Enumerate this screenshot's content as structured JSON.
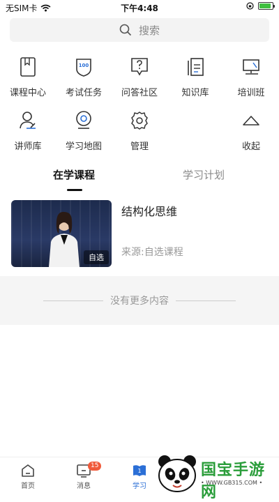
{
  "status": {
    "carrier": "无SIM卡",
    "time": "下午4:48"
  },
  "search": {
    "placeholder": "搜索"
  },
  "grid": {
    "row1": [
      {
        "label": "课程中心",
        "icon": "bookmark-book-icon"
      },
      {
        "label": "考试任务",
        "icon": "exam-shield-icon"
      },
      {
        "label": "问答社区",
        "icon": "question-bubble-icon"
      },
      {
        "label": "知识库",
        "icon": "knowledge-book-icon"
      },
      {
        "label": "培训班",
        "icon": "training-screen-icon"
      }
    ],
    "row2": [
      {
        "label": "讲师库",
        "icon": "lecturer-icon"
      },
      {
        "label": "学习地图",
        "icon": "map-pin-icon"
      },
      {
        "label": "管理",
        "icon": "gear-icon"
      },
      {
        "label": "收起",
        "icon": "collapse-up-icon"
      }
    ]
  },
  "tabs": {
    "active": "在学课程",
    "inactive": "学习计划"
  },
  "course": {
    "title": "结构化思维",
    "source": "来源:自选课程",
    "tag": "自选"
  },
  "no_more": "没有更多内容",
  "nav": {
    "home": "首页",
    "messages": "消息",
    "messages_badge": "15",
    "learn": "学习",
    "learn_icon_text": "1"
  },
  "watermark": {
    "title": "国宝手游网",
    "url": "• WWW.GB315.COM •"
  },
  "colors": {
    "accent": "#2b6fd6",
    "badge": "#f05a3a",
    "icon_stroke": "#333333"
  }
}
